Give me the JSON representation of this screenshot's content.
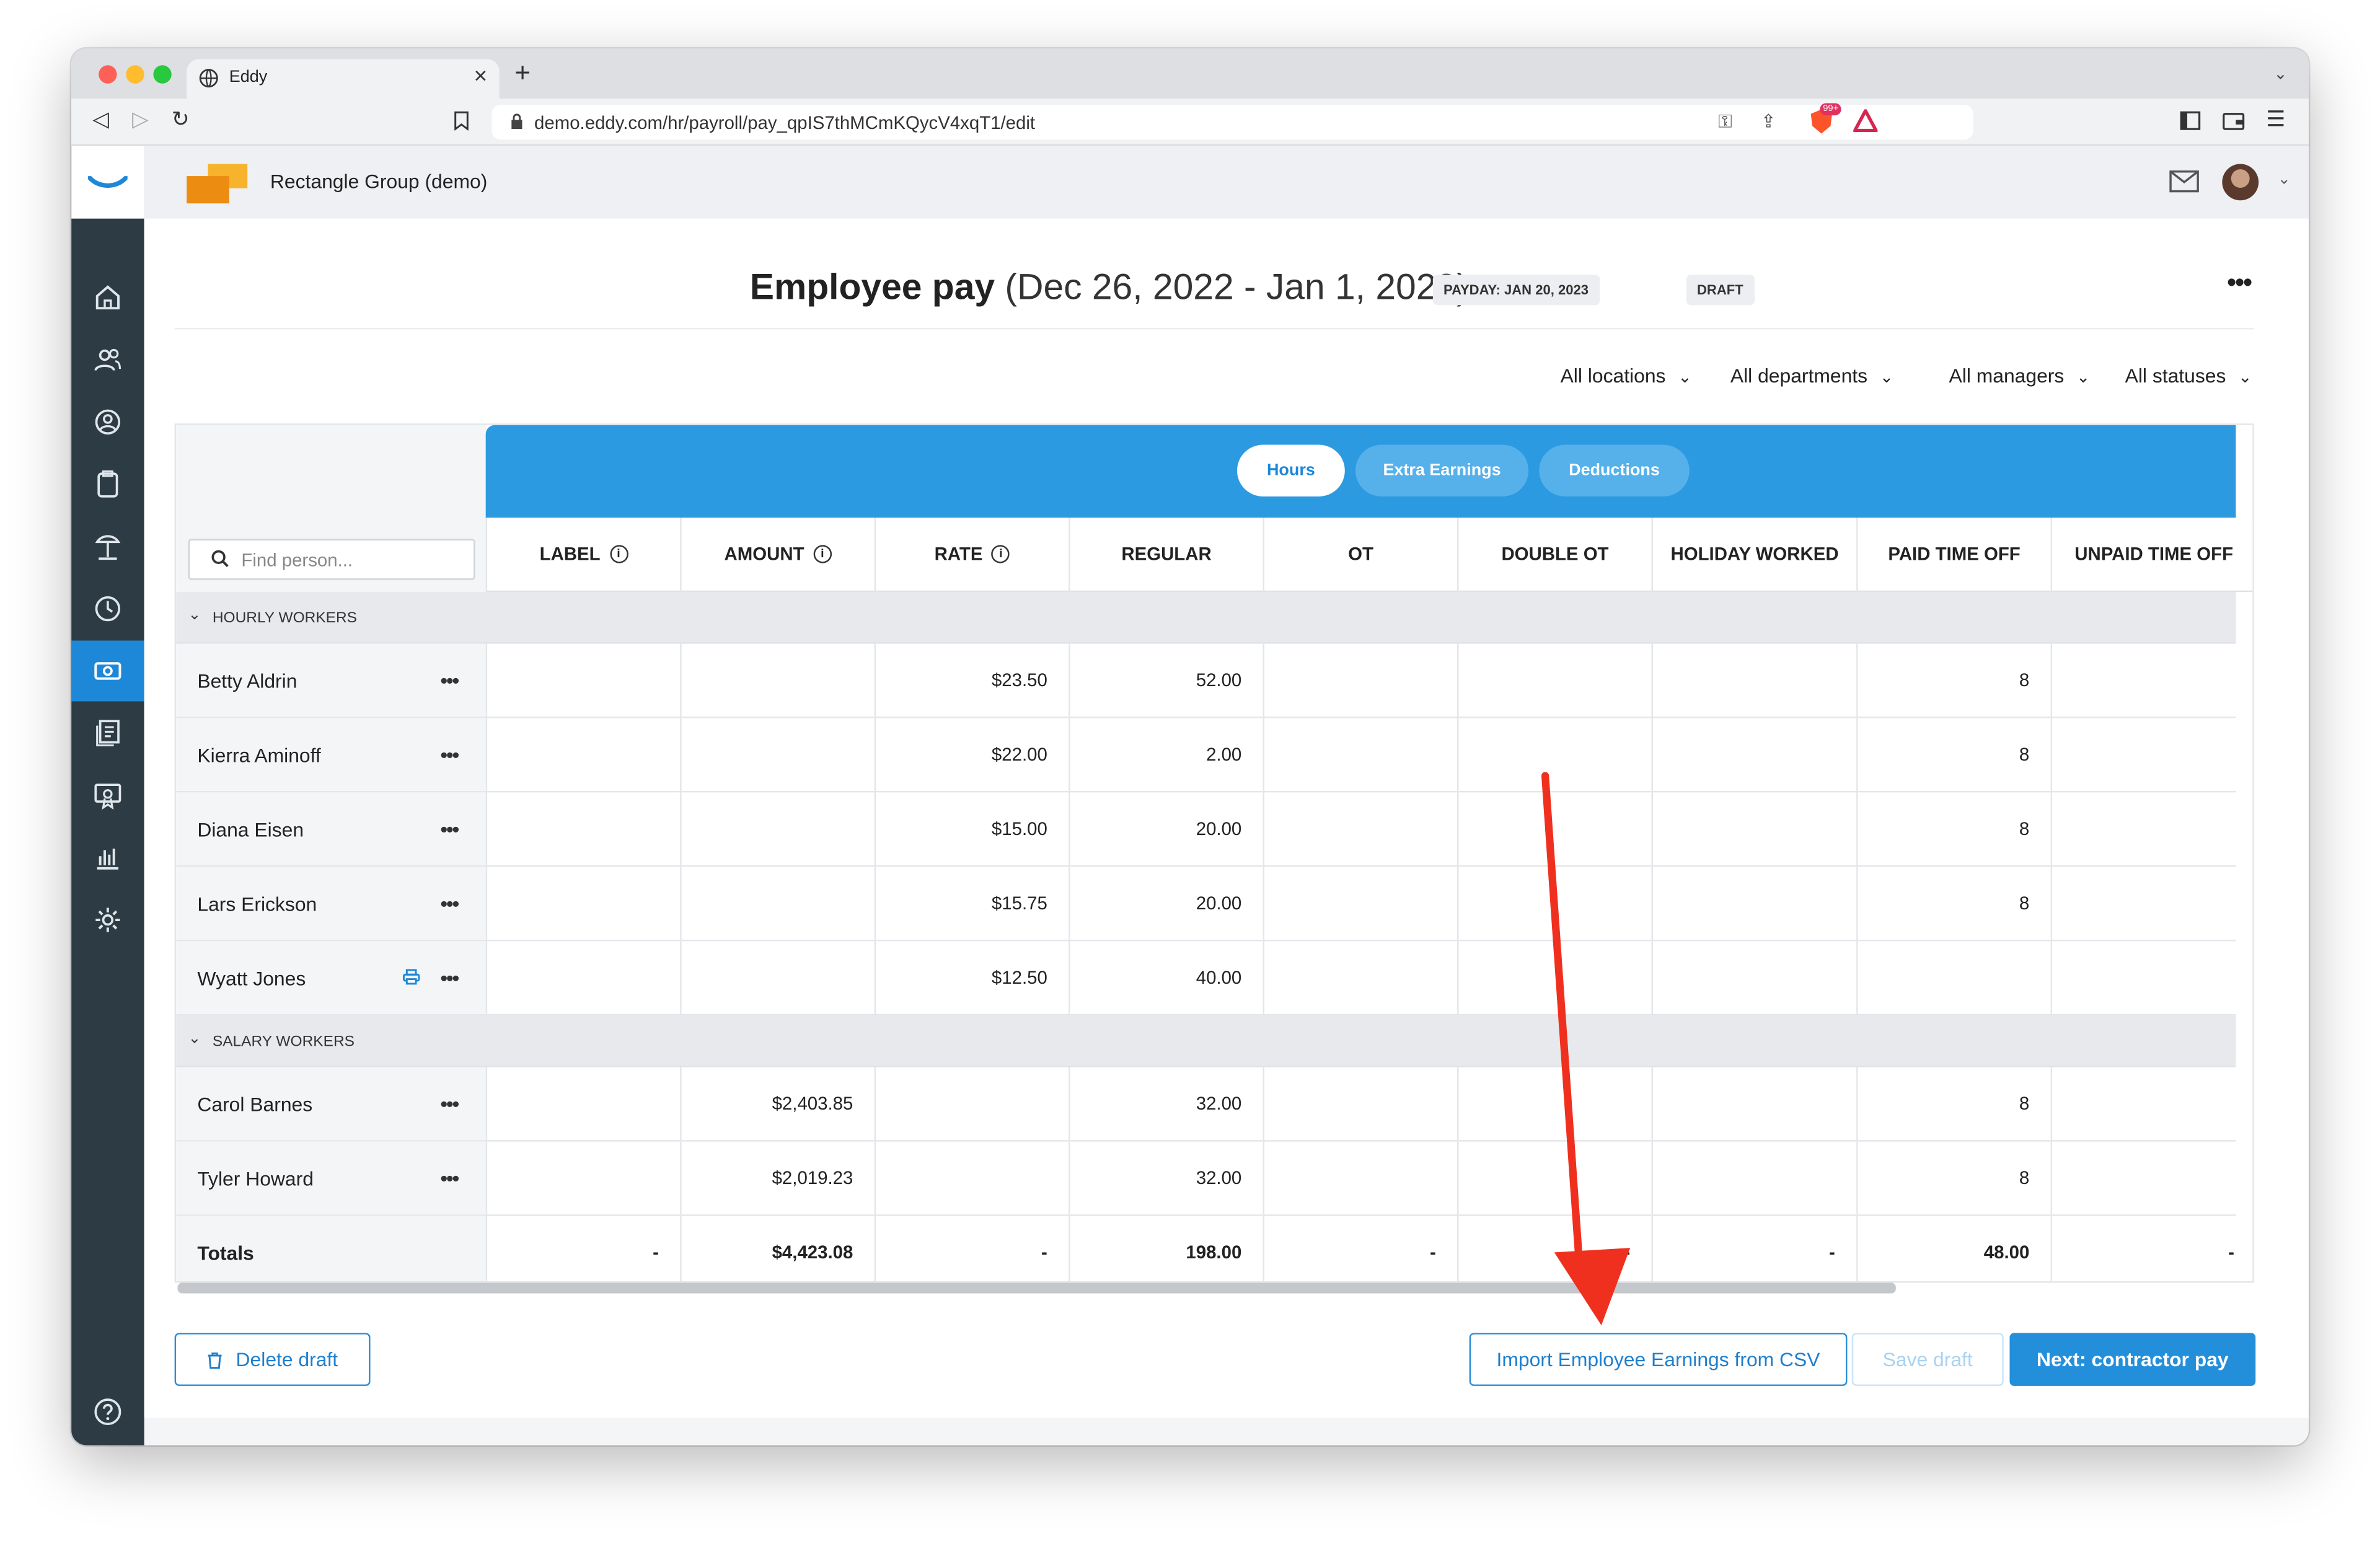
{
  "browser": {
    "tab_title": "Eddy",
    "tab_close": "×",
    "new_tab": "+",
    "url": "demo.eddy.com/hr/payroll/pay_qpIS7thMCmKQycV4xqT1/edit",
    "extension_badge": "99+"
  },
  "topbar": {
    "company_name": "Rectangle Group (demo)"
  },
  "sidebar": {
    "items": [
      "home-icon",
      "people-icon",
      "person-search-icon",
      "clipboard-icon",
      "beach-icon",
      "clock-icon",
      "payroll-icon",
      "documents-icon",
      "certificate-icon",
      "reports-icon",
      "settings-icon"
    ],
    "active": "payroll-icon"
  },
  "page": {
    "title_bold": "Employee pay",
    "title_range": "(Dec 26, 2022 - Jan 1, 2023)",
    "payday_badge": "PAYDAY: JAN 20, 2023",
    "status_badge": "DRAFT",
    "more": "•••"
  },
  "filters": {
    "locations": "All locations",
    "departments": "All departments",
    "managers": "All managers",
    "statuses": "All statuses"
  },
  "tabs": {
    "hours": "Hours",
    "extra_earnings": "Extra Earnings",
    "deductions": "Deductions",
    "active": "Hours"
  },
  "search": {
    "placeholder": "Find person..."
  },
  "columns": {
    "label": "LABEL",
    "amount": "AMOUNT",
    "rate": "RATE",
    "regular": "REGULAR",
    "ot": "OT",
    "double_ot": "DOUBLE OT",
    "holiday_worked": "HOLIDAY WORKED",
    "paid_time_off": "PAID TIME OFF",
    "unpaid_time_off": "UNPAID TIME OFF"
  },
  "sections": {
    "hourly": "HOURLY WORKERS",
    "salary": "SALARY WORKERS"
  },
  "row_menu": "•••",
  "hourly_rows": [
    {
      "name": "Betty Aldrin",
      "label": "",
      "amount": "",
      "rate": "$23.50",
      "regular": "52.00",
      "ot": "",
      "double_ot": "",
      "holiday": "",
      "pto": "8",
      "unpaid": ""
    },
    {
      "name": "Kierra Aminoff",
      "label": "",
      "amount": "",
      "rate": "$22.00",
      "regular": "2.00",
      "ot": "",
      "double_ot": "",
      "holiday": "",
      "pto": "8",
      "unpaid": ""
    },
    {
      "name": "Diana Eisen",
      "label": "",
      "amount": "",
      "rate": "$15.00",
      "regular": "20.00",
      "ot": "",
      "double_ot": "",
      "holiday": "",
      "pto": "8",
      "unpaid": ""
    },
    {
      "name": "Lars Erickson",
      "label": "",
      "amount": "",
      "rate": "$15.75",
      "regular": "20.00",
      "ot": "",
      "double_ot": "",
      "holiday": "",
      "pto": "8",
      "unpaid": ""
    },
    {
      "name": "Wyatt Jones",
      "label": "",
      "amount": "",
      "rate": "$12.50",
      "regular": "40.00",
      "ot": "",
      "double_ot": "",
      "holiday": "",
      "pto": "",
      "unpaid": ""
    }
  ],
  "salary_rows": [
    {
      "name": "Carol Barnes",
      "label": "",
      "amount": "$2,403.85",
      "rate": "",
      "regular": "32.00",
      "ot": "",
      "double_ot": "",
      "holiday": "",
      "pto": "8",
      "unpaid": ""
    },
    {
      "name": "Tyler Howard",
      "label": "",
      "amount": "$2,019.23",
      "rate": "",
      "regular": "32.00",
      "ot": "",
      "double_ot": "",
      "holiday": "",
      "pto": "8",
      "unpaid": ""
    }
  ],
  "totals": {
    "name": "Totals",
    "label": "-",
    "amount": "$4,423.08",
    "rate": "-",
    "regular": "198.00",
    "ot": "-",
    "double_ot": "-",
    "holiday": "-",
    "pto": "48.00",
    "unpaid": "-"
  },
  "buttons": {
    "delete_draft": "Delete draft",
    "import_csv": "Import Employee Earnings from CSV",
    "save_draft": "Save draft",
    "next": "Next: contractor pay"
  },
  "colors": {
    "accent": "#238fdb",
    "sidebar": "#2d3b45",
    "annotation_arrow": "#f0301e"
  }
}
